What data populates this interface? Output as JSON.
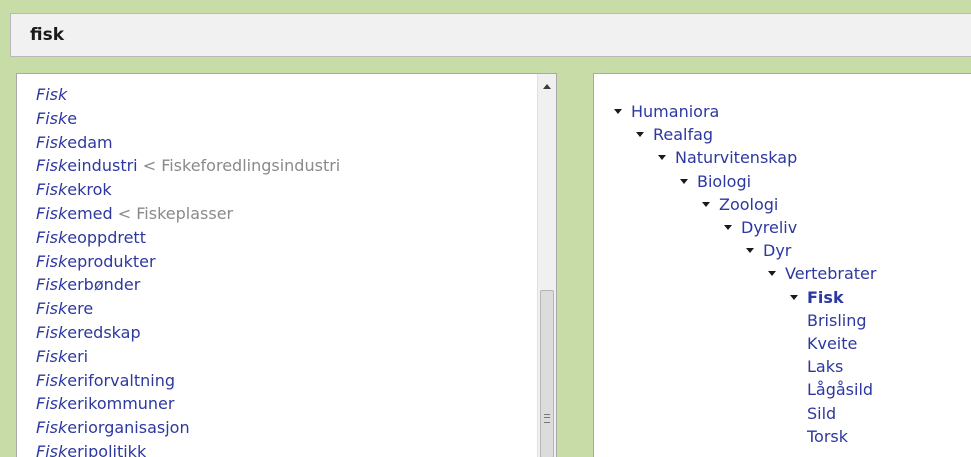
{
  "search": {
    "value": "fisk"
  },
  "results": [
    {
      "match": "Fisk",
      "rest": "",
      "alt": ""
    },
    {
      "match": "Fisk",
      "rest": "e",
      "alt": ""
    },
    {
      "match": "Fisk",
      "rest": "edam",
      "alt": ""
    },
    {
      "match": "Fisk",
      "rest": "eindustri",
      "alt": "< Fiskeforedlingsindustri"
    },
    {
      "match": "Fisk",
      "rest": "ekrok",
      "alt": ""
    },
    {
      "match": "Fisk",
      "rest": "emed",
      "alt": "< Fiskeplasser"
    },
    {
      "match": "Fisk",
      "rest": "eoppdrett",
      "alt": ""
    },
    {
      "match": "Fisk",
      "rest": "eprodukter",
      "alt": ""
    },
    {
      "match": "Fisk",
      "rest": "erbønder",
      "alt": ""
    },
    {
      "match": "Fisk",
      "rest": "ere",
      "alt": ""
    },
    {
      "match": "Fisk",
      "rest": "eredskap",
      "alt": ""
    },
    {
      "match": "Fisk",
      "rest": "eri",
      "alt": ""
    },
    {
      "match": "Fisk",
      "rest": "eriforvaltning",
      "alt": ""
    },
    {
      "match": "Fisk",
      "rest": "erikommuner",
      "alt": ""
    },
    {
      "match": "Fisk",
      "rest": "eriorganisasjon",
      "alt": ""
    },
    {
      "match": "Fisk",
      "rest": "eripolitikk",
      "alt": ""
    }
  ],
  "tree": [
    {
      "label": "Humaniora",
      "level": 0,
      "expanded": true,
      "current": false
    },
    {
      "label": "Realfag",
      "level": 1,
      "expanded": true,
      "current": false
    },
    {
      "label": "Naturvitenskap",
      "level": 2,
      "expanded": true,
      "current": false
    },
    {
      "label": "Biologi",
      "level": 3,
      "expanded": true,
      "current": false
    },
    {
      "label": "Zoologi",
      "level": 4,
      "expanded": true,
      "current": false
    },
    {
      "label": "Dyreliv",
      "level": 5,
      "expanded": true,
      "current": false
    },
    {
      "label": "Dyr",
      "level": 6,
      "expanded": true,
      "current": false
    },
    {
      "label": "Vertebrater",
      "level": 7,
      "expanded": true,
      "current": false
    },
    {
      "label": "Fisk",
      "level": 8,
      "expanded": true,
      "current": true
    },
    {
      "label": "Brisling",
      "level": 9,
      "expanded": false,
      "current": false
    },
    {
      "label": "Kveite",
      "level": 9,
      "expanded": false,
      "current": false
    },
    {
      "label": "Laks",
      "level": 9,
      "expanded": false,
      "current": false
    },
    {
      "label": "Lågåsild",
      "level": 9,
      "expanded": false,
      "current": false
    },
    {
      "label": "Sild",
      "level": 9,
      "expanded": false,
      "current": false
    },
    {
      "label": "Torsk",
      "level": 9,
      "expanded": false,
      "current": false
    }
  ],
  "icons": {
    "expand": "caret-down-icon",
    "scroll_up": "arrow-up-icon",
    "grip": "scroll-grip-icon"
  }
}
